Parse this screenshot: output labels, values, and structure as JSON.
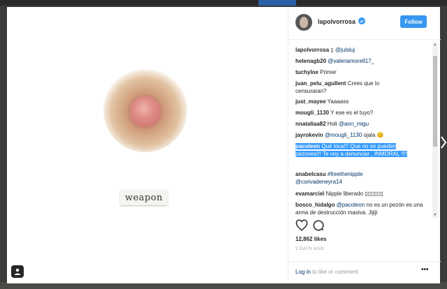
{
  "post": {
    "username": "lapolvorrosa",
    "follow_label": "Follow",
    "art_label": "weapon"
  },
  "comments": [
    {
      "user": "lapolvorrosa",
      "text": " ▯ ",
      "mention": "@julsluj"
    },
    {
      "user": "helenagb20",
      "text": " ",
      "mention": "@valeriamorell17_"
    },
    {
      "user": "tuchyloe",
      "text": " Primer",
      "mention": ""
    },
    {
      "user": "juan_pelu_agullent",
      "text": " Crees que lo censuraran?",
      "mention": ""
    },
    {
      "user": "just_mayee",
      "text": " Yaaaass",
      "mention": ""
    },
    {
      "user": "mougli_1130",
      "text": " Y ese es el tuyo?",
      "mention": ""
    },
    {
      "user": "nnataliaa82",
      "text": " Holi ",
      "mention": "@ann_migu"
    },
    {
      "user": "jayrokevin",
      "text": " ",
      "mention": "@mougli_1130",
      "after": " ojala 😊"
    },
    {
      "user": "pacoleon",
      "text": " Qué loca!!! Que no se pueden pezones!!! Te voy a denunciar , INMORAL !!!!"
    },
    {
      "user": "anabelcasu",
      "text": " ",
      "mention": "#freethenipple",
      "line2": "@csrivadeneyra14"
    },
    {
      "user": "evamarciel",
      "text": " Nipple liberado ▯▯▯▯▯▯"
    },
    {
      "user": "bosco_hidalgo",
      "text": " ",
      "mention": "@pacoleon",
      "after": " no es un pezón es una arma de destrucción masiva. Jijiji"
    }
  ],
  "likes": "12,862 likes",
  "date": "2 DAYS AGO",
  "footer": {
    "login_link": "Log in",
    "login_rest": " to like or comment.",
    "more": "•••"
  }
}
